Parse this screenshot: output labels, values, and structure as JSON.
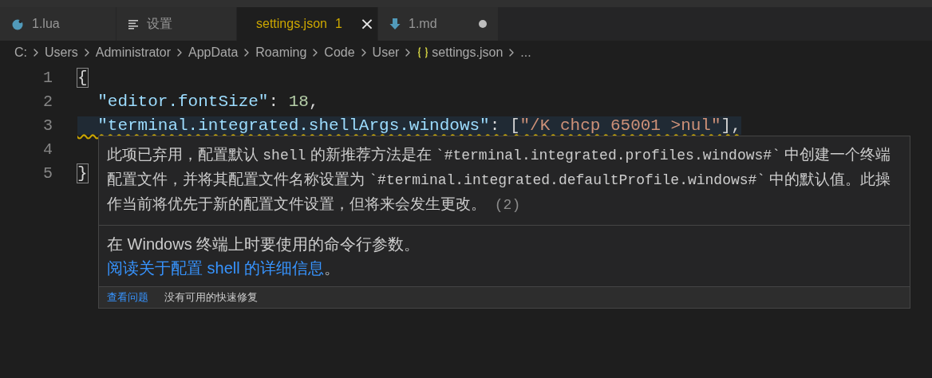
{
  "tabs": [
    {
      "label": "1.lua",
      "kind": "lua",
      "selected": false,
      "modified": false
    },
    {
      "label": "设置",
      "kind": "settings",
      "selected": false,
      "modified": false
    },
    {
      "label": "settings.json",
      "kind": "json",
      "selected": true,
      "problems": "1",
      "modified": false,
      "close": "×"
    },
    {
      "label": "1.md",
      "kind": "markdown",
      "selected": false,
      "modified": true
    }
  ],
  "breadcrumbs": [
    {
      "label": "C:",
      "kind": "folder"
    },
    {
      "label": "Users",
      "kind": "folder"
    },
    {
      "label": "Administrator",
      "kind": "folder"
    },
    {
      "label": "AppData",
      "kind": "folder"
    },
    {
      "label": "Roaming",
      "kind": "folder"
    },
    {
      "label": "Code",
      "kind": "folder"
    },
    {
      "label": "User",
      "kind": "folder"
    },
    {
      "label": "settings.json",
      "kind": "json"
    },
    {
      "label": "...",
      "kind": "folder"
    }
  ],
  "code_lines": [
    {
      "number": "1",
      "highlighted": false,
      "warning": false,
      "tokens": [
        {
          "text": "{",
          "kind": "bracket"
        }
      ]
    },
    {
      "number": "2",
      "highlighted": false,
      "warning": false,
      "tokens": [
        {
          "text": "  \"editor.fontSize\"",
          "kind": "key"
        },
        {
          "text": ": ",
          "kind": "punct"
        },
        {
          "text": "18",
          "kind": "number"
        },
        {
          "text": ",",
          "kind": "punct"
        }
      ]
    },
    {
      "number": "3",
      "highlighted": true,
      "warning": true,
      "tokens": [
        {
          "text": "  \"terminal.integrated.shellArgs.windows\"",
          "kind": "key"
        },
        {
          "text": ": ",
          "kind": "punct"
        },
        {
          "text": "[",
          "kind": "punct"
        },
        {
          "text": "\"/K chcp 65001 >nul\"",
          "kind": "string"
        },
        {
          "text": "],",
          "kind": "punct"
        }
      ]
    },
    {
      "number": "4"
    },
    {
      "number": "5",
      "highlighted": false,
      "warning": false,
      "tokens": [
        {
          "text": "}",
          "kind": "bracket"
        }
      ]
    }
  ],
  "hover": {
    "message": [
      {
        "text": "此项已弃用，配置默认 ",
        "kind": "prose"
      },
      {
        "text": "shell",
        "kind": "code"
      },
      {
        "text": " 的新推荐方法是在 ",
        "kind": "prose"
      },
      {
        "text": "`#terminal.integrated.profiles.windows#`",
        "kind": "code"
      },
      {
        "text": " 中创建一个终端配置文件，并将其配置文件名称设置为 ",
        "kind": "prose"
      },
      {
        "text": "`#terminal.integrated.defaultProfile.windows#`",
        "kind": "code"
      },
      {
        "text": " 中的默认值。此操作当前将优先于新的配置文件设置，但将来会发生更改。",
        "kind": "prose"
      },
      {
        "text": " (2)",
        "kind": "count"
      }
    ],
    "description": {
      "text": "在 Windows 终端上时要使用的命令行参数。",
      "link": "阅读关于配置 shell 的详细信息",
      "end": "。"
    },
    "actions": [
      {
        "label": "查看问题",
        "kind": "link"
      },
      {
        "label": "没有可用的快速修复",
        "kind": "text"
      }
    ]
  }
}
